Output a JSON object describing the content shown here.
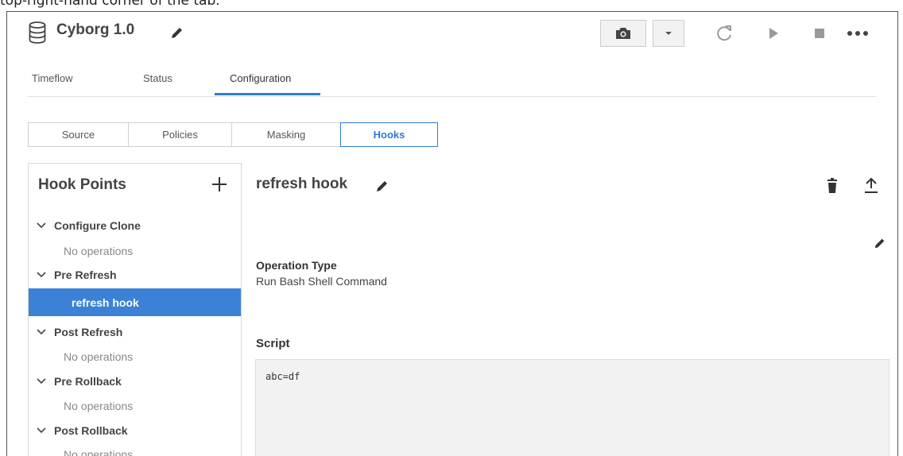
{
  "caption": "top-right-hand corner of the tab.",
  "header": {
    "title": "Cyborg 1.0"
  },
  "tabs": [
    {
      "label": "Timeflow"
    },
    {
      "label": "Status"
    },
    {
      "label": "Configuration",
      "active": true
    }
  ],
  "subtabs": [
    {
      "label": "Source"
    },
    {
      "label": "Policies"
    },
    {
      "label": "Masking"
    },
    {
      "label": "Hooks",
      "active": true
    }
  ],
  "hook_points": {
    "title": "Hook Points",
    "groups": [
      {
        "label": "Configure Clone",
        "sub": "No operations"
      },
      {
        "label": "Pre Refresh",
        "sub": "refresh hook",
        "selected": true
      },
      {
        "label": "Post Refresh",
        "sub": "No operations"
      },
      {
        "label": "Pre Rollback",
        "sub": "No operations"
      },
      {
        "label": "Post Rollback",
        "sub": "No operations"
      }
    ]
  },
  "detail": {
    "title": "refresh hook",
    "operation_type_label": "Operation Type",
    "operation_type_value": "Run Bash Shell Command",
    "script_label": "Script",
    "script_value": "abc=df"
  },
  "colors": {
    "accent": "#2d7bd6",
    "selected_bg": "#3b82d6"
  },
  "icons": [
    "database-icon",
    "pencil-icon",
    "camera-icon",
    "caret-down-icon",
    "refresh-icon",
    "play-icon",
    "stop-icon",
    "more-icon",
    "plus-icon",
    "chevron-down-icon",
    "trash-icon",
    "upload-icon"
  ]
}
